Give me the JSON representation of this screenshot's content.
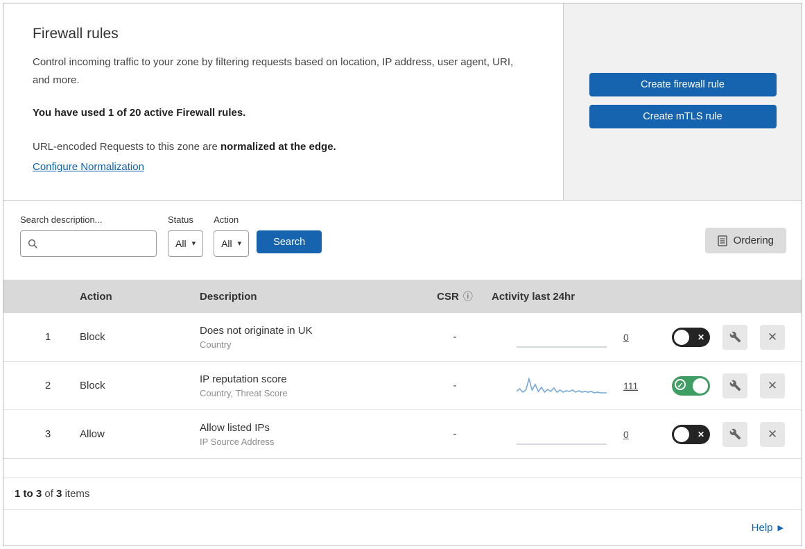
{
  "header": {
    "title": "Firewall rules",
    "description": "Control incoming traffic to your zone by filtering requests based on location, IP address, user agent, URI, and more.",
    "usage": "You have used 1 of 20 active Firewall rules.",
    "normalization_prefix": "URL-encoded Requests to this zone are ",
    "normalization_bold": "normalized at the edge.",
    "normalization_link": "Configure Normalization",
    "create_firewall_button": "Create firewall rule",
    "create_mtls_button": "Create mTLS rule"
  },
  "filters": {
    "search_label": "Search description...",
    "status_label": "Status",
    "status_value": "All",
    "action_label": "Action",
    "action_value": "All",
    "search_button": "Search",
    "ordering_button": "Ordering"
  },
  "table": {
    "columns": {
      "action": "Action",
      "description": "Description",
      "csr": "CSR",
      "activity": "Activity last 24hr"
    },
    "rows": [
      {
        "priority": "1",
        "action": "Block",
        "description": "Does not originate in UK",
        "fields": "Country",
        "csr": "-",
        "activity_count": "0",
        "enabled": false,
        "sparkline": "flat"
      },
      {
        "priority": "2",
        "action": "Block",
        "description": "IP reputation score",
        "fields": "Country, Threat Score",
        "csr": "-",
        "activity_count": "111",
        "enabled": true,
        "sparkline": [
          25,
          21,
          26,
          23,
          7,
          23,
          15,
          25,
          19,
          26,
          22,
          25,
          20,
          26,
          23,
          26,
          24,
          25,
          23,
          26,
          24,
          26,
          25,
          26,
          25,
          27,
          26,
          27,
          27,
          27
        ]
      },
      {
        "priority": "3",
        "action": "Allow",
        "description": "Allow listed IPs",
        "fields": "IP Source Address",
        "csr": "-",
        "activity_count": "0",
        "enabled": false,
        "sparkline": "flat"
      }
    ]
  },
  "footer": {
    "range": "1 to 3",
    "of_text": "of",
    "total": "3",
    "items_text": "items",
    "help_label": "Help"
  },
  "icons": {
    "caret_down": "▾",
    "info": "ⓘ",
    "close": "✕",
    "check": "✓",
    "help_arrow": "▶"
  },
  "colors": {
    "accent_blue": "#1663b0",
    "link_blue": "#0f62b4",
    "toggle_on_green": "#3f9e63",
    "sparkline_blue": "#74a9d8"
  }
}
